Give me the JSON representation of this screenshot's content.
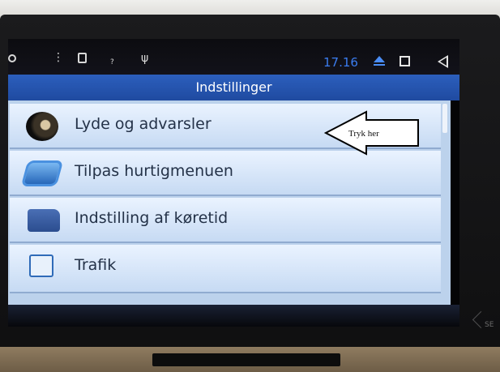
{
  "status_bar": {
    "time": "17.16",
    "icons": [
      "circle-icon",
      "overflow-menu-icon",
      "sd-card-icon",
      "wifi-question-icon",
      "usb-icon",
      "eject-icon",
      "recent-apps-icon",
      "back-icon"
    ]
  },
  "header": {
    "title": "Indstillinger"
  },
  "menu": {
    "items": [
      {
        "label": "Lyde og advarsler",
        "icon": "speaker-icon"
      },
      {
        "label": "Tilpas hurtigmenuen",
        "icon": "quick-menu-icon"
      },
      {
        "label": "Indstilling af køretid",
        "icon": "truck-icon"
      },
      {
        "label": "Trafik",
        "icon": "traffic-icon"
      }
    ]
  },
  "annotation": {
    "text": "Tryk her"
  },
  "bezel": {
    "corner_label": "SE"
  },
  "colors": {
    "accent": "#2c5fbd",
    "time": "#3b7df0",
    "row": "#dceafb"
  }
}
